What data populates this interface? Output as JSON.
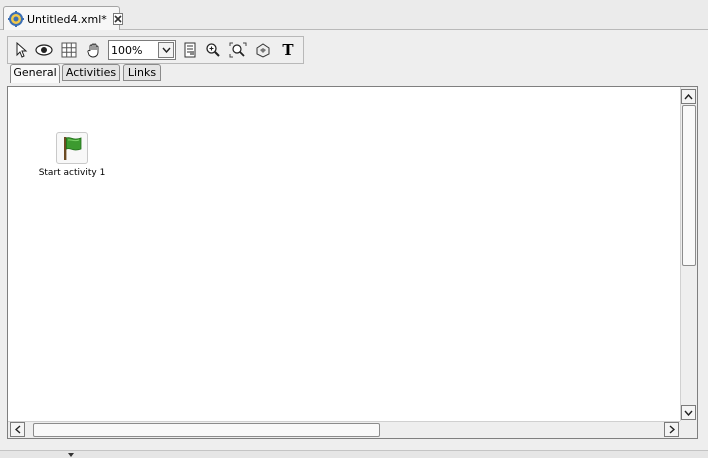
{
  "document_tab": {
    "title": "Untitled4.xml*",
    "icon": "app-gear-icon",
    "close_icon": "close-icon"
  },
  "toolbar": {
    "tools": [
      "select-arrow-icon",
      "eye-icon",
      "grid-icon",
      "hand-pan-icon"
    ],
    "zoom_value": "100%",
    "after_zoom_tools": [
      "fit-page-icon",
      "zoom-in-icon",
      "zoom-fit-icon",
      "overview-icon"
    ],
    "text_tool_label": "T"
  },
  "inner_tabs": [
    {
      "label": "General",
      "active": true
    },
    {
      "label": "Activities",
      "active": false
    },
    {
      "label": "Links",
      "active": false
    }
  ],
  "canvas": {
    "nodes": [
      {
        "label": "Start activity 1",
        "icon": "green-flag-icon"
      }
    ]
  },
  "colors": {
    "flag_green": "#3c9a2f",
    "background": "#eeeeee"
  }
}
